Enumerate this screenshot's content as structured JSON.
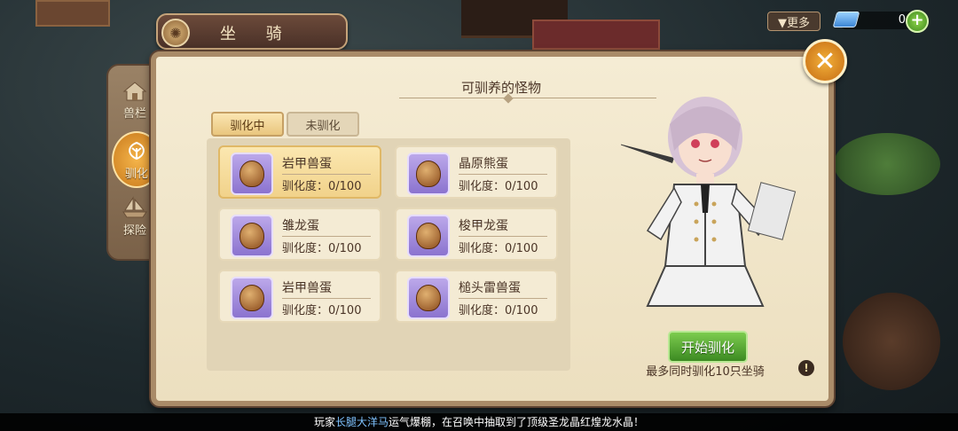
{
  "header": {
    "title": "坐 骑"
  },
  "top_right": {
    "more_label": "▼更多",
    "currency_value": "0",
    "plus_label": "+"
  },
  "side_nav": [
    {
      "label": "兽栏",
      "icon": "house-icon"
    },
    {
      "label": "驯化",
      "icon": "flower-icon"
    },
    {
      "label": "探险",
      "icon": "boat-icon"
    }
  ],
  "panel": {
    "title": "可驯养的怪物",
    "tabs": [
      {
        "label": "驯化中",
        "active": true
      },
      {
        "label": "未驯化",
        "active": false
      }
    ],
    "monsters": [
      {
        "name": "岩甲兽蛋",
        "progress": "驯化度：0/100"
      },
      {
        "name": "晶原熊蛋",
        "progress": "驯化度：0/100"
      },
      {
        "name": "雏龙蛋",
        "progress": "驯化度：0/100"
      },
      {
        "name": "梭甲龙蛋",
        "progress": "驯化度：0/100"
      },
      {
        "name": "岩甲兽蛋",
        "progress": "驯化度：0/100"
      },
      {
        "name": "槌头雷兽蛋",
        "progress": "驯化度：0/100"
      }
    ],
    "start_button": "开始驯化",
    "limit_text": "最多同时驯化10只坐骑",
    "info_icon": "!"
  },
  "ticker": {
    "prefix": "玩家",
    "player": "长腿大洋马",
    "suffix": "运气爆棚，在召唤中抽取到了顶级圣龙晶红煌龙水晶！"
  }
}
